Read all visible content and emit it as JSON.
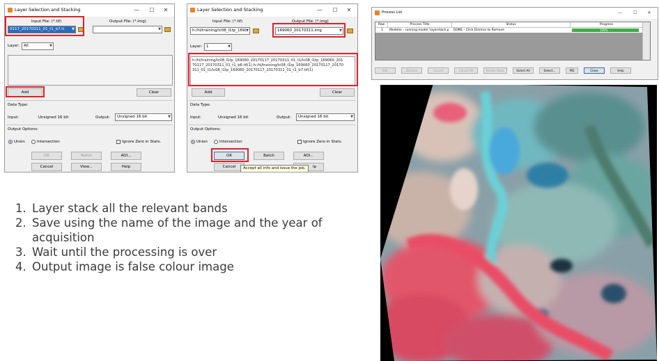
{
  "dialog1": {
    "title": "Layer Selection and Stacking",
    "minimize": "—",
    "maximize": "☐",
    "close": "✕",
    "input_label": "Input File: (*.tif)",
    "input_value": "0117_20170311_01_t1_b7.ti",
    "output_label": "Output File: (*.img)",
    "output_value": "",
    "layer_label": "Layer:",
    "layer_value": "All",
    "add_label": "Add",
    "clear_label": "Clear",
    "data_type_label": "Data Type:",
    "input_type_label": "Input:",
    "input_type_value": "Unsigned 16 bit",
    "output_type_label": "Output:",
    "output_type_value": "Unsigned 16 bit",
    "output_options_label": "Output Options:",
    "union_label": "Union",
    "intersection_label": "Intersection",
    "ignore_zero_label": "Ignore Zero in Stats.",
    "ok_label": "OK",
    "batch_label": "Batch",
    "aoi_label": "AOI...",
    "cancel_label": "Cancel",
    "view_label": "View...",
    "help_label": "Help"
  },
  "dialog2": {
    "title": "Layer Selection and Stacking",
    "minimize": "—",
    "maximize": "☐",
    "close": "✕",
    "input_label": "Input File: (*.tif)",
    "input_value": "h:/hl/training/lc08_l1tp_169(",
    "output_label": "Output File: (*.img)",
    "output_value": "169060_20170311.img",
    "layer_label": "Layer:",
    "layer_value": "1",
    "list_text": "h:/hl/training/lc08_l1tp_169060_20170117_20170311_01_t1/lc08_l1tp_169060_20170117_20170311_01_t1_b6.tif(1) h:/hl/training/lc08_l1tp_169060_20170117_20170311_01_t1/lc08_l1tp_169060_20170117_20170311_01_t1_b7.tif(1)",
    "add_label": "Add",
    "clear_label": "Clear",
    "data_type_label": "Data Type:",
    "input_type_label": "Input:",
    "input_type_value": "Unsigned 16 bit",
    "output_type_label": "Output:",
    "output_type_value": "Unsigned 16 bit",
    "output_options_label": "Output Options:",
    "union_label": "Union",
    "intersection_label": "Intersection",
    "ignore_zero_label": "Ignore Zero in Stats.",
    "ok_label": "OK",
    "batch_label": "Batch",
    "aoi_label": "AOI...",
    "cancel_label": "Cancel",
    "help_fragment": "lp",
    "tooltip": "Accept all info and issue the job."
  },
  "process_list": {
    "title": "Process List",
    "minimize": "—",
    "maximize": "☐",
    "close": "✕",
    "columns": [
      "Row",
      "Process Title",
      "Status",
      "Progress"
    ],
    "row": {
      "index": "1",
      "title": "Modeler - running model 'layerstack.p",
      "status": "DONE - Click Dismiss to Remove",
      "progress_text": "100%",
      "progress_fraction": 1.0
    },
    "buttons": [
      "Edit",
      "Dismiss",
      "Cancel",
      "Cancel All",
      "Delete Rows",
      "Select All",
      "Select...",
      "PID",
      "Close",
      "Help"
    ],
    "accent": "#3cb043"
  },
  "steps": [
    {
      "num": "1.",
      "text": "Layer stack all the relevant bands"
    },
    {
      "num": "2.",
      "text": "Save using the name of the image and the year of acquisition"
    },
    {
      "num": "3.",
      "text": "Wait until the processing is over"
    },
    {
      "num": "4.",
      "text": "Output image is false colour image"
    }
  ],
  "highlight_color": "#e0202a"
}
